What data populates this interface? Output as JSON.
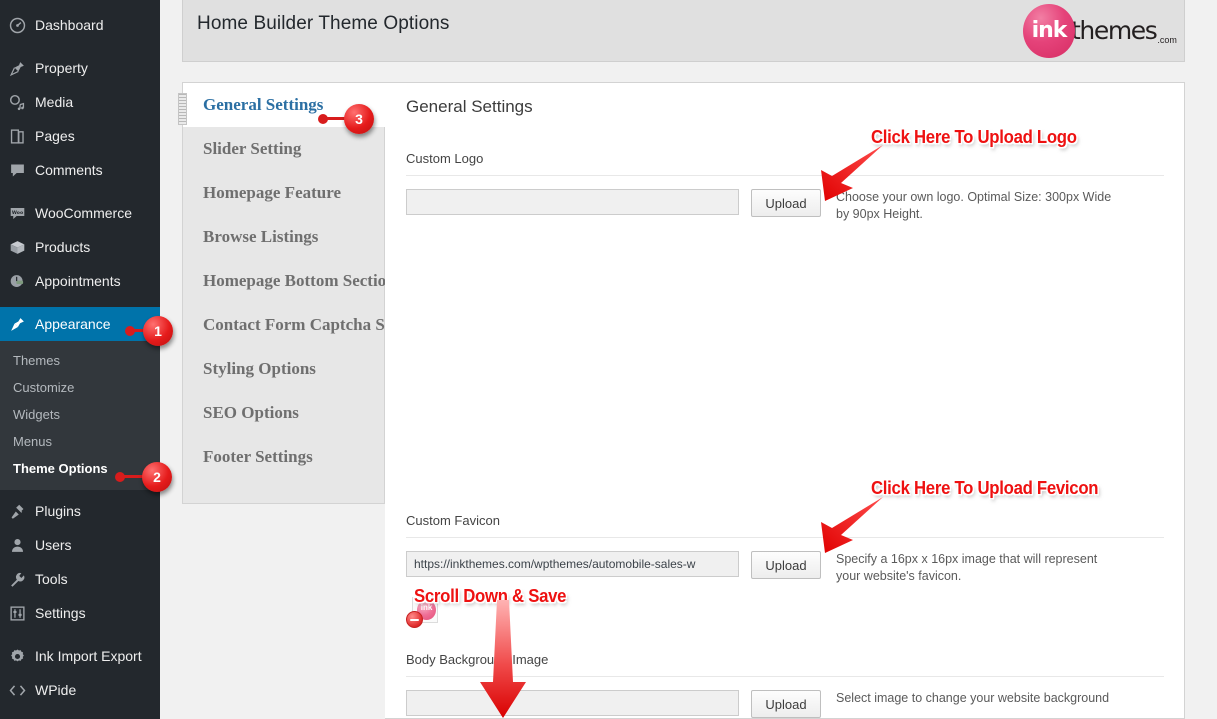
{
  "sidebar": {
    "items": [
      {
        "label": "Dashboard",
        "icon": "dashboard-icon",
        "name": "dashboard"
      },
      {
        "label": "Property",
        "icon": "pin-icon",
        "name": "property"
      },
      {
        "label": "Media",
        "icon": "media-icon",
        "name": "media"
      },
      {
        "label": "Pages",
        "icon": "pages-icon",
        "name": "pages"
      },
      {
        "label": "Comments",
        "icon": "comments-icon",
        "name": "comments"
      },
      {
        "label": "WooCommerce",
        "icon": "woocommerce-icon",
        "name": "woocommerce"
      },
      {
        "label": "Products",
        "icon": "products-box-icon",
        "name": "products"
      },
      {
        "label": "Appointments",
        "icon": "appointments-icon",
        "name": "appointments"
      },
      {
        "label": "Appearance",
        "icon": "appearance-brush-icon",
        "name": "appearance",
        "current": true
      },
      {
        "label": "Plugins",
        "icon": "plugins-plug-icon",
        "name": "plugins"
      },
      {
        "label": "Users",
        "icon": "users-icon",
        "name": "users"
      },
      {
        "label": "Tools",
        "icon": "tools-wrench-icon",
        "name": "tools"
      },
      {
        "label": "Settings",
        "icon": "settings-sliders-icon",
        "name": "settings"
      },
      {
        "label": "Ink Import Export",
        "icon": "gear-icon",
        "name": "ink-import-export"
      },
      {
        "label": "WPide",
        "icon": "code-brackets-icon",
        "name": "wpide"
      }
    ],
    "submenu": [
      {
        "label": "Themes",
        "name": "themes"
      },
      {
        "label": "Customize",
        "name": "customize"
      },
      {
        "label": "Widgets",
        "name": "widgets"
      },
      {
        "label": "Menus",
        "name": "menus"
      },
      {
        "label": "Theme Options",
        "name": "theme-options",
        "current": true
      }
    ]
  },
  "header": {
    "title": "Home Builder Theme Options",
    "brand": {
      "ink": "ink",
      "word": "themes",
      "com": ".com"
    }
  },
  "tabs": [
    {
      "label": "General Settings",
      "name": "general-settings",
      "active": true
    },
    {
      "label": "Slider Setting",
      "name": "slider-setting"
    },
    {
      "label": "Homepage Feature",
      "name": "homepage-feature"
    },
    {
      "label": "Browse Listings",
      "name": "browse-listings"
    },
    {
      "label": "Homepage Bottom Section",
      "name": "homepage-bottom-section"
    },
    {
      "label": "Contact Form Captcha Section",
      "name": "contact-form-captcha-section"
    },
    {
      "label": "Styling Options",
      "name": "styling-options"
    },
    {
      "label": "SEO Options",
      "name": "seo-options"
    },
    {
      "label": "Footer Settings",
      "name": "footer-settings"
    }
  ],
  "panel": {
    "section_title": "General Settings",
    "fields": [
      {
        "name": "custom-logo",
        "label": "Custom Logo",
        "value": "",
        "placeholder": "",
        "button": "Upload",
        "description": "Choose your own logo. Optimal Size: 300px Wide by 90px Height."
      },
      {
        "name": "custom-favicon",
        "label": "Custom Favicon",
        "value": "https://inkthemes.com/wpthemes/automobile-sales-w",
        "placeholder": "",
        "button": "Upload",
        "description": "Specify a 16px x 16px image that will represent your website's favicon."
      },
      {
        "name": "body-background-image",
        "label": "Body Background Image",
        "value": "",
        "placeholder": "",
        "button": "Upload",
        "description": "Select image to change your website background"
      }
    ]
  },
  "annotations": {
    "callouts": [
      {
        "name": "upload-logo-callout",
        "text": "Click Here To Upload Logo"
      },
      {
        "name": "upload-favicon-callout",
        "text": "Click Here To Upload Fevicon"
      },
      {
        "name": "scroll-down-save-callout",
        "text": "Scroll Down & Save"
      }
    ],
    "badges": [
      {
        "name": "step-badge-1",
        "number": "1"
      },
      {
        "name": "step-badge-2",
        "number": "2"
      },
      {
        "name": "step-badge-3",
        "number": "3"
      }
    ]
  },
  "colors": {
    "admin_bg": "#23282d",
    "submenu_bg": "#32373c",
    "current_blue": "#0073aa",
    "annotation_red": "#ee1111",
    "brand_pink": "#e5437a",
    "tab_active_text": "#2b6fa3"
  }
}
